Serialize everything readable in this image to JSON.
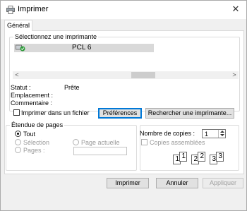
{
  "window": {
    "title": "Imprimer",
    "close_glyph": "✕"
  },
  "tabs": [
    {
      "label": "Général"
    }
  ],
  "select_printer": {
    "group_title": "Sélectionnez une imprimante",
    "printers": [
      {
        "name": "PCL 6",
        "icon": "printer-check-icon"
      }
    ],
    "scroll_left": "<",
    "scroll_right": ">"
  },
  "info": {
    "status_label": "Statut :",
    "status_value": "Prête",
    "location_label": "Emplacement :",
    "comment_label": "Commentaire :"
  },
  "print_to_file": {
    "label": "Imprimer dans un fichier",
    "checked": false
  },
  "buttons": {
    "preferences": "Préférences",
    "find_printer": "Rechercher une imprimante...",
    "print": "Imprimer",
    "cancel": "Annuler",
    "apply": "Appliquer"
  },
  "page_range": {
    "group_title": "Étendue de pages",
    "all": "Tout",
    "selection": "Sélection",
    "current_page": "Page actuelle",
    "pages": "Pages :",
    "selected": "all"
  },
  "copies": {
    "label": "Nombre de copies :",
    "value": "1",
    "collate_label": "Copies assemblées",
    "collate_pages": [
      "1",
      "1",
      "2",
      "2",
      "3",
      "3"
    ]
  },
  "colors": {
    "accent": "#0078d7",
    "green_check": "#2e9a3a"
  }
}
